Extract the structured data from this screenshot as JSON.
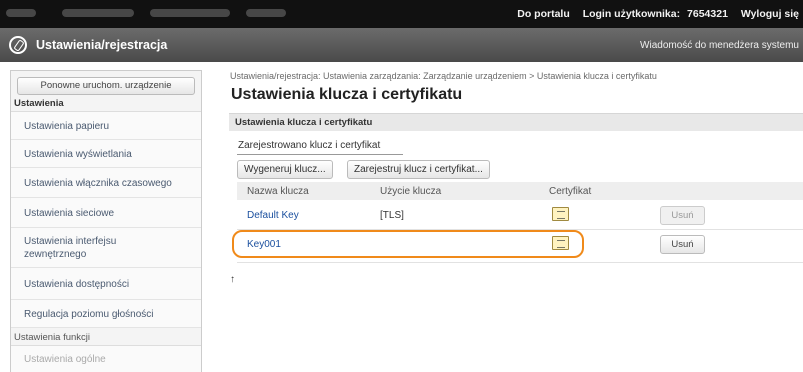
{
  "topbar": {
    "portal_link": "Do portalu",
    "login_label": "Login użytkownika:",
    "login_value": "7654321",
    "logout": "Wyloguj się"
  },
  "header": {
    "title": "Ustawienia/rejestracja",
    "message": "Wiadomość do menedżera systemu"
  },
  "sidebar": {
    "restart_button": "Ponowne uruchom. urządzenie",
    "section_settings": "Ustawienia",
    "items": [
      {
        "label": "Ustawienia papieru"
      },
      {
        "label": "Ustawienia wyświetlania"
      },
      {
        "label": "Ustawienia włącznika czasowego"
      },
      {
        "label": "Ustawienia sieciowe"
      },
      {
        "label": "Ustawienia interfejsu"
      },
      {
        "label": "Ustawienia dostępności"
      },
      {
        "label": "Regulacja poziomu głośności"
      }
    ],
    "interface_line2": "zewnętrznego",
    "section_functions": "Ustawienia funkcji",
    "functions_items": [
      {
        "label": "Ustawienia ogólne"
      }
    ]
  },
  "main": {
    "breadcrumb": "Ustawienia/rejestracja: Ustawienia zarządzania: Zarządzanie urządzeniem > Ustawienia klucza i certyfikatu",
    "page_title": "Ustawienia klucza i certyfikatu",
    "panel_title": "Ustawienia klucza i certyfikatu",
    "registered_heading": "Zarejestrowano klucz i certyfikat",
    "generate_button": "Wygeneruj klucz...",
    "register_button": "Zarejestruj klucz i certyfikat...",
    "columns": {
      "name": "Nazwa klucza",
      "usage": "Użycie klucza",
      "certificate": "Certyfikat"
    },
    "rows": [
      {
        "name": "Default Key",
        "usage": "[TLS]",
        "delete": "Usuń"
      },
      {
        "name": "Key001",
        "usage": "",
        "delete": "Usuń"
      }
    ]
  },
  "colors": {
    "highlight": "#f08a1a",
    "link": "#1a4f9e"
  }
}
